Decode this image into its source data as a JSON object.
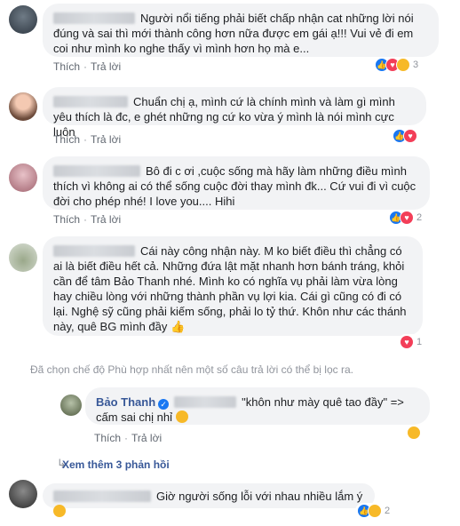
{
  "comments": [
    {
      "text": "Người nổi tiếng phải biết chấp nhận cat những lời nói đúng và sai thì mới thành công hơn nữa được em gái ạ!!! Vui vẻ đi em coi như mình ko nghe thấy vì mình hơn họ mà e...",
      "like_label": "Thích",
      "reply_label": "Trả lời",
      "reaction_count": "3",
      "reactions": [
        "like",
        "love",
        "haha"
      ]
    },
    {
      "text": "Chuẩn chị ạ, mình cứ là chính mình và làm gì mình yêu thích là đc, e ghét những ng cứ ko vừa ý mình là nói mình cực luôn",
      "like_label": "Thích",
      "reply_label": "Trả lời",
      "reaction_count": "",
      "reactions": [
        "like",
        "love"
      ]
    },
    {
      "text": "Bô đi c ơi ,cuộc sống mà hãy làm những điều mình thích vì không ai có thể sống cuộc đời thay mình đk... Cứ vui đi vì cuộc đời cho phép nhé! I love you.... Hihi",
      "like_label": "Thích",
      "reply_label": "Trả lời",
      "reaction_count": "2",
      "reactions": [
        "like",
        "love"
      ]
    },
    {
      "text": "Cái này công nhận này. M ko biết điều thì chẳng có ai là biết điều hết cả. Những đứa lật mặt nhanh hơn bánh tráng, khỏi cần để tâm Bảo Thanh nhé. Mình ko có nghĩa vụ phải làm vừa lòng hay chiều lòng với những thành phần vụ lợi kia. Cái gì cũng có đi có lại. Nghệ sỹ cũng phải kiếm sống, phải lo tỷ thứ. Khôn như các thánh này, quê BG mình đầy",
      "like_label": "Thích",
      "reply_label": "Trả lời",
      "reaction_count": "1",
      "reactions": [
        "love"
      ]
    }
  ],
  "filter_note": "Đã chọn chế độ Phù hợp nhất nên một số câu trả lời có thể bị lọc ra.",
  "reply": {
    "author": "Bảo Thanh",
    "text": "\"khôn như mày quê tao đầy\" => cấm sai chị nhỉ",
    "like_label": "Thích",
    "reply_label": "Trả lời",
    "reactions": [
      "haha"
    ]
  },
  "see_more": "Xem thêm 3 phản hồi",
  "last_comment": {
    "text": "Giờ người sống lỗi với nhau nhiều lắm ý",
    "reaction_count": "2",
    "reactions": [
      "like",
      "haha"
    ]
  },
  "colors": {
    "bubble": "#f2f3f5",
    "link": "#385898",
    "like": "#1877f2",
    "love": "#f33e58",
    "haha": "#f7b928"
  }
}
